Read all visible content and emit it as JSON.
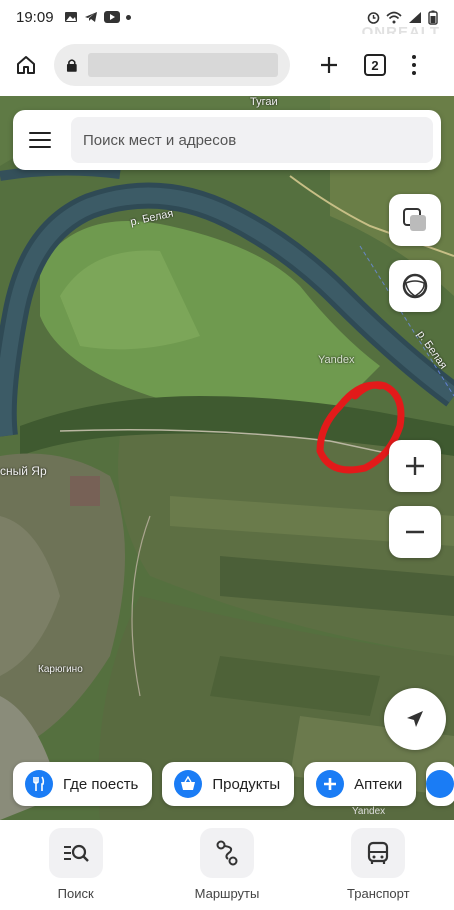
{
  "status_bar": {
    "time": "19:09",
    "watermark": "ONREALT"
  },
  "browser": {
    "tab_count": "2"
  },
  "search": {
    "placeholder": "Поиск мест и адресов"
  },
  "map": {
    "labels": {
      "top": "Тугаи",
      "river_1": "р. Белая",
      "river_2": "р. Белая",
      "provider": "Yandex",
      "village_1": "сный Яр",
      "village_2": "Карюгино",
      "attribution": "Yandex"
    },
    "highlight_color": "#e21a1a"
  },
  "chips": [
    {
      "label": "Где поесть",
      "icon": "fork-knife-icon"
    },
    {
      "label": "Продукты",
      "icon": "basket-icon"
    },
    {
      "label": "Аптеки",
      "icon": "plus-icon"
    }
  ],
  "tabs": [
    {
      "label": "Поиск",
      "icon": "search-list-icon"
    },
    {
      "label": "Маршруты",
      "icon": "route-icon"
    },
    {
      "label": "Транспорт",
      "icon": "bus-icon"
    }
  ],
  "colors": {
    "accent": "#1a7cf5"
  }
}
